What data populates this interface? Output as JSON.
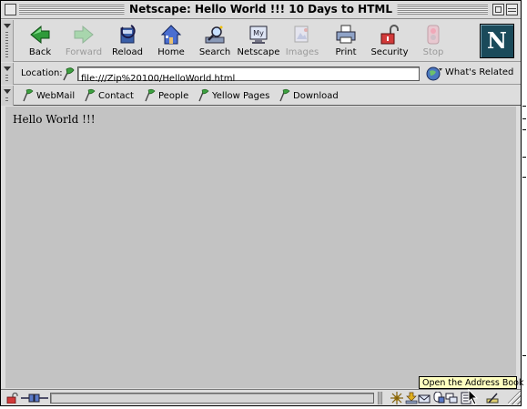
{
  "window": {
    "title": "Netscape: Hello World !!! 10 Days to HTML"
  },
  "navigation_toolbar": {
    "buttons": [
      {
        "label": "Back",
        "icon": "back-arrow-icon",
        "enabled": true
      },
      {
        "label": "Forward",
        "icon": "forward-arrow-icon",
        "enabled": false
      },
      {
        "label": "Reload",
        "icon": "reload-icon",
        "enabled": true
      },
      {
        "label": "Home",
        "icon": "home-icon",
        "enabled": true
      },
      {
        "label": "Search",
        "icon": "search-icon",
        "enabled": true
      },
      {
        "label": "Netscape",
        "icon": "my-netscape-icon",
        "enabled": true
      },
      {
        "label": "Images",
        "icon": "images-icon",
        "enabled": false
      },
      {
        "label": "Print",
        "icon": "printer-icon",
        "enabled": true
      },
      {
        "label": "Security",
        "icon": "security-lock-icon",
        "enabled": true
      },
      {
        "label": "Stop",
        "icon": "stop-icon",
        "enabled": false
      }
    ],
    "logo_letter": "N"
  },
  "location_bar": {
    "label": "Location:",
    "url": "file:///Zip%20100/HelloWorld.html",
    "whats_related": "What's Related"
  },
  "personal_toolbar": {
    "items": [
      {
        "label": "WebMail"
      },
      {
        "label": "Contact"
      },
      {
        "label": "People"
      },
      {
        "label": "Yellow Pages"
      },
      {
        "label": "Download"
      }
    ]
  },
  "page": {
    "text": "Hello World !!!"
  },
  "status_bar": {
    "progress": 0,
    "tooltip": "Open the Address Book"
  },
  "colors": {
    "page_background": "#c3c3c3",
    "chrome": "#dddddd",
    "tooltip_background": "#ffffc0",
    "logo_background": "#1a4a5a",
    "disabled_text": "#9a9a9a"
  }
}
